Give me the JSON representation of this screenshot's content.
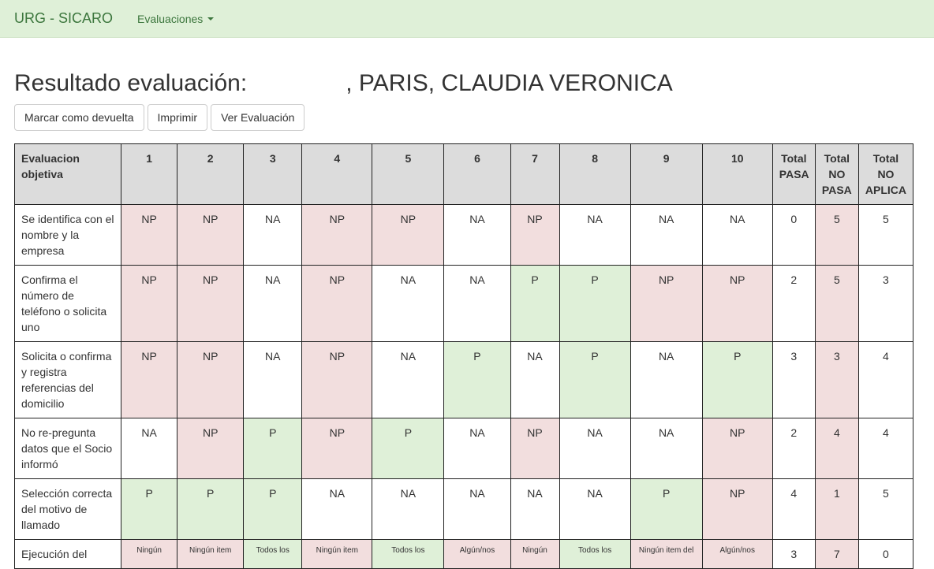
{
  "nav": {
    "brand": "URG - SICARO",
    "menu": "Evaluaciones"
  },
  "page": {
    "title_prefix": "Resultado evaluación:",
    "title_name": ", PARIS, CLAUDIA VERONICA"
  },
  "buttons": {
    "mark_returned": "Marcar como devuelta",
    "print": "Imprimir",
    "view": "Ver Evaluación"
  },
  "table": {
    "headers": [
      "Evaluacion objetiva",
      "1",
      "2",
      "3",
      "4",
      "5",
      "6",
      "7",
      "8",
      "9",
      "10",
      "Total PASA",
      "Total NO PASA",
      "Total NO APLICA"
    ],
    "rows": [
      {
        "criterion": "Se identifica con el nombre y la empresa",
        "values": [
          "NP",
          "NP",
          "NA",
          "NP",
          "NP",
          "NA",
          "NP",
          "NA",
          "NA",
          "NA"
        ],
        "pasa": "0",
        "no_pasa": "5",
        "no_aplica": "5"
      },
      {
        "criterion": "Confirma el número de teléfono o solicita uno",
        "values": [
          "NP",
          "NP",
          "NA",
          "NP",
          "NA",
          "NA",
          "P",
          "P",
          "NP",
          "NP"
        ],
        "pasa": "2",
        "no_pasa": "5",
        "no_aplica": "3"
      },
      {
        "criterion": "Solicita o confirma y registra referencias del domicilio",
        "values": [
          "NP",
          "NP",
          "NA",
          "NP",
          "NA",
          "P",
          "NA",
          "P",
          "NA",
          "P"
        ],
        "pasa": "3",
        "no_pasa": "3",
        "no_aplica": "4"
      },
      {
        "criterion": "No re-pregunta datos que el Socio informó",
        "values": [
          "NA",
          "NP",
          "P",
          "NP",
          "P",
          "NA",
          "NP",
          "NA",
          "NA",
          "NP"
        ],
        "pasa": "2",
        "no_pasa": "4",
        "no_aplica": "4"
      },
      {
        "criterion": "Selección correcta del motivo de llamado",
        "values": [
          "P",
          "P",
          "P",
          "NA",
          "NA",
          "NA",
          "NA",
          "NA",
          "P",
          "NP"
        ],
        "pasa": "4",
        "no_pasa": "1",
        "no_aplica": "5"
      },
      {
        "criterion": "Ejecución del",
        "values": [
          "Ningún",
          "Ningún item",
          "Todos los",
          "Ningún item",
          "Todos los",
          "Algún/nos",
          "Ningún",
          "Todos los",
          "Ningún item del",
          "Algún/nos"
        ],
        "classes": [
          "np",
          "np",
          "p",
          "np",
          "p",
          "np",
          "np",
          "p",
          "np",
          "np"
        ],
        "pasa": "3",
        "no_pasa": "7",
        "no_aplica": "0"
      }
    ]
  },
  "colors": {
    "navbar": "#dff0d8",
    "np_cell": "#f2dede",
    "p_cell": "#dff0d8",
    "header_cell": "#dcdcdc"
  }
}
